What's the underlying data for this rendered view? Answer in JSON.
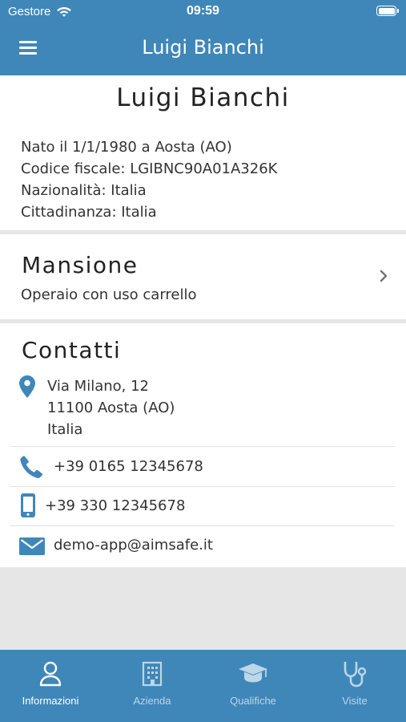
{
  "status_bar": {
    "carrier": "Gestore",
    "time": "09:59"
  },
  "header": {
    "title": "Luigi Bianchi"
  },
  "person": {
    "name": "Luigi Bianchi",
    "birth": "Nato il 1/1/1980 a Aosta (AO)",
    "fiscal_code": "Codice fiscale: LGIBNC90A01A326K",
    "nationality": "Nazionalità: Italia",
    "citizenship": "Cittadinanza: Italia"
  },
  "job": {
    "title": "Mansione",
    "value": "Operaio con uso carrello"
  },
  "contacts": {
    "title": "Contatti",
    "address": [
      "Via Milano, 12",
      "11100 Aosta (AO)",
      "Italia"
    ],
    "phone": "+39 0165 12345678",
    "mobile": "+39 330 12345678",
    "email": "demo-app@aimsafe.it"
  },
  "tabs": [
    {
      "label": "Informazioni",
      "icon": "user-icon",
      "active": true
    },
    {
      "label": "Azienda",
      "icon": "building-icon",
      "active": false
    },
    {
      "label": "Qualifiche",
      "icon": "graduation-cap-icon",
      "active": false
    },
    {
      "label": "Visite",
      "icon": "stethoscope-icon",
      "active": false
    }
  ],
  "colors": {
    "primary": "#3f87b9",
    "background": "#e6e6e6",
    "tab_inactive": "#bcd6ea"
  }
}
